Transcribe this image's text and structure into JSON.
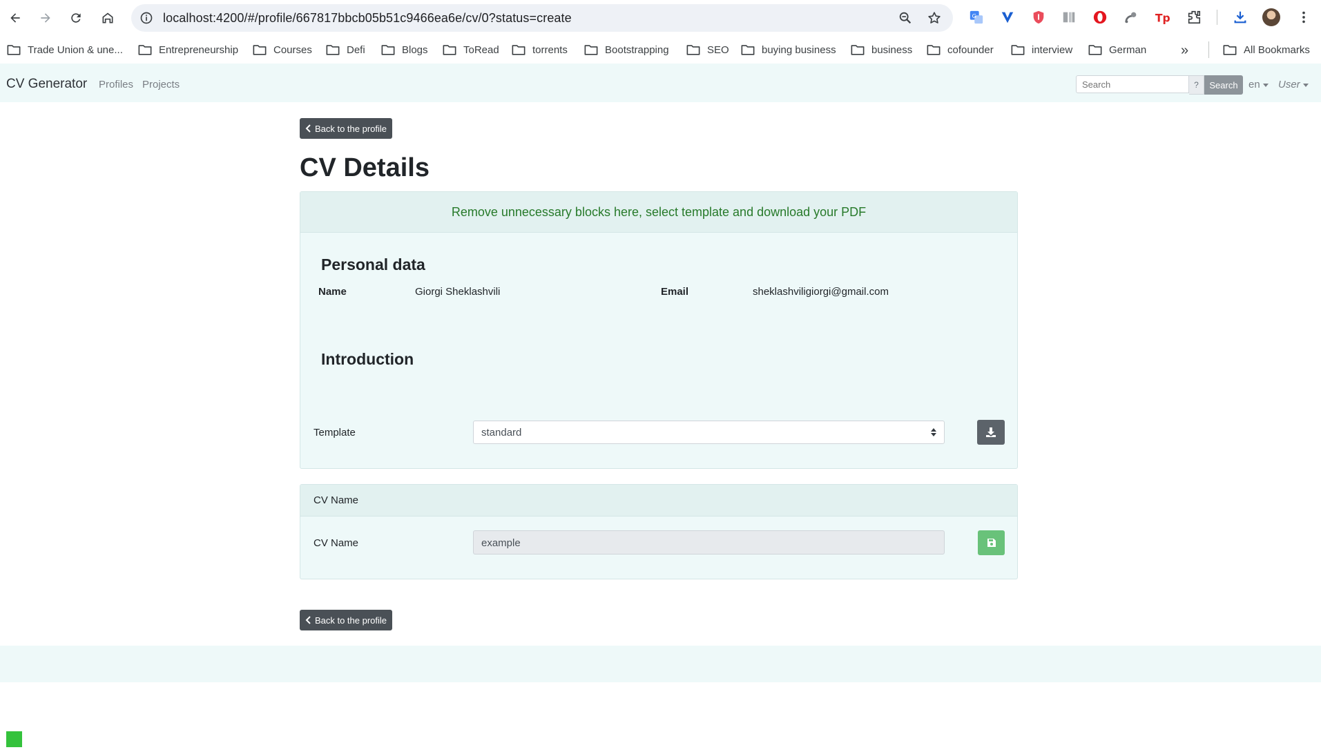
{
  "browser": {
    "url": "localhost:4200/#/profile/667817bbcb05b51c9466ea6e/cv/0?status=create",
    "nav_icons": [
      "back-arrow-icon",
      "forward-arrow-icon",
      "reload-icon",
      "home-icon"
    ],
    "extension_icons": [
      "google-translate-icon",
      "v-extension-icon",
      "shield-extension-icon",
      "reader-icon",
      "opera-icon",
      "satellite-icon",
      "tp-icon",
      "puzzle-extensions-icon",
      "download-icon"
    ],
    "bookmarks": [
      "Trade Union & une...",
      "Entrepreneurship",
      "Courses",
      "Defi",
      "Blogs",
      "ToRead",
      "torrents",
      "Bootstrapping",
      "SEO",
      "buying business",
      "business",
      "cofounder",
      "interview",
      "German"
    ],
    "more_bookmarks": "»",
    "all_bookmarks": "All Bookmarks"
  },
  "navbar": {
    "brand": "CV Generator",
    "links": [
      "Profiles",
      "Projects"
    ],
    "search_placeholder": "Search",
    "search_help": "?",
    "search_button": "Search",
    "language": "en",
    "user": "User"
  },
  "page": {
    "back_label": "Back to the profile",
    "title": "CV Details",
    "info_banner": "Remove unnecessary blocks here, select template and download your PDF",
    "personal_title": "Personal data",
    "name_label": "Name",
    "name_value": "Giorgi Sheklashvili",
    "email_label": "Email",
    "email_value": "sheklashviligiorgi@gmail.com",
    "intro_title": "Introduction",
    "template_label": "Template",
    "template_value": "standard",
    "cv_name_header": "CV Name",
    "cv_name_label": "CV Name",
    "cv_name_value": "example"
  },
  "colors": {
    "accent_bg": "#eef9f9",
    "banner_text": "#277a2a",
    "dark_button": "#4a5056",
    "save_button": "#69c27a"
  }
}
